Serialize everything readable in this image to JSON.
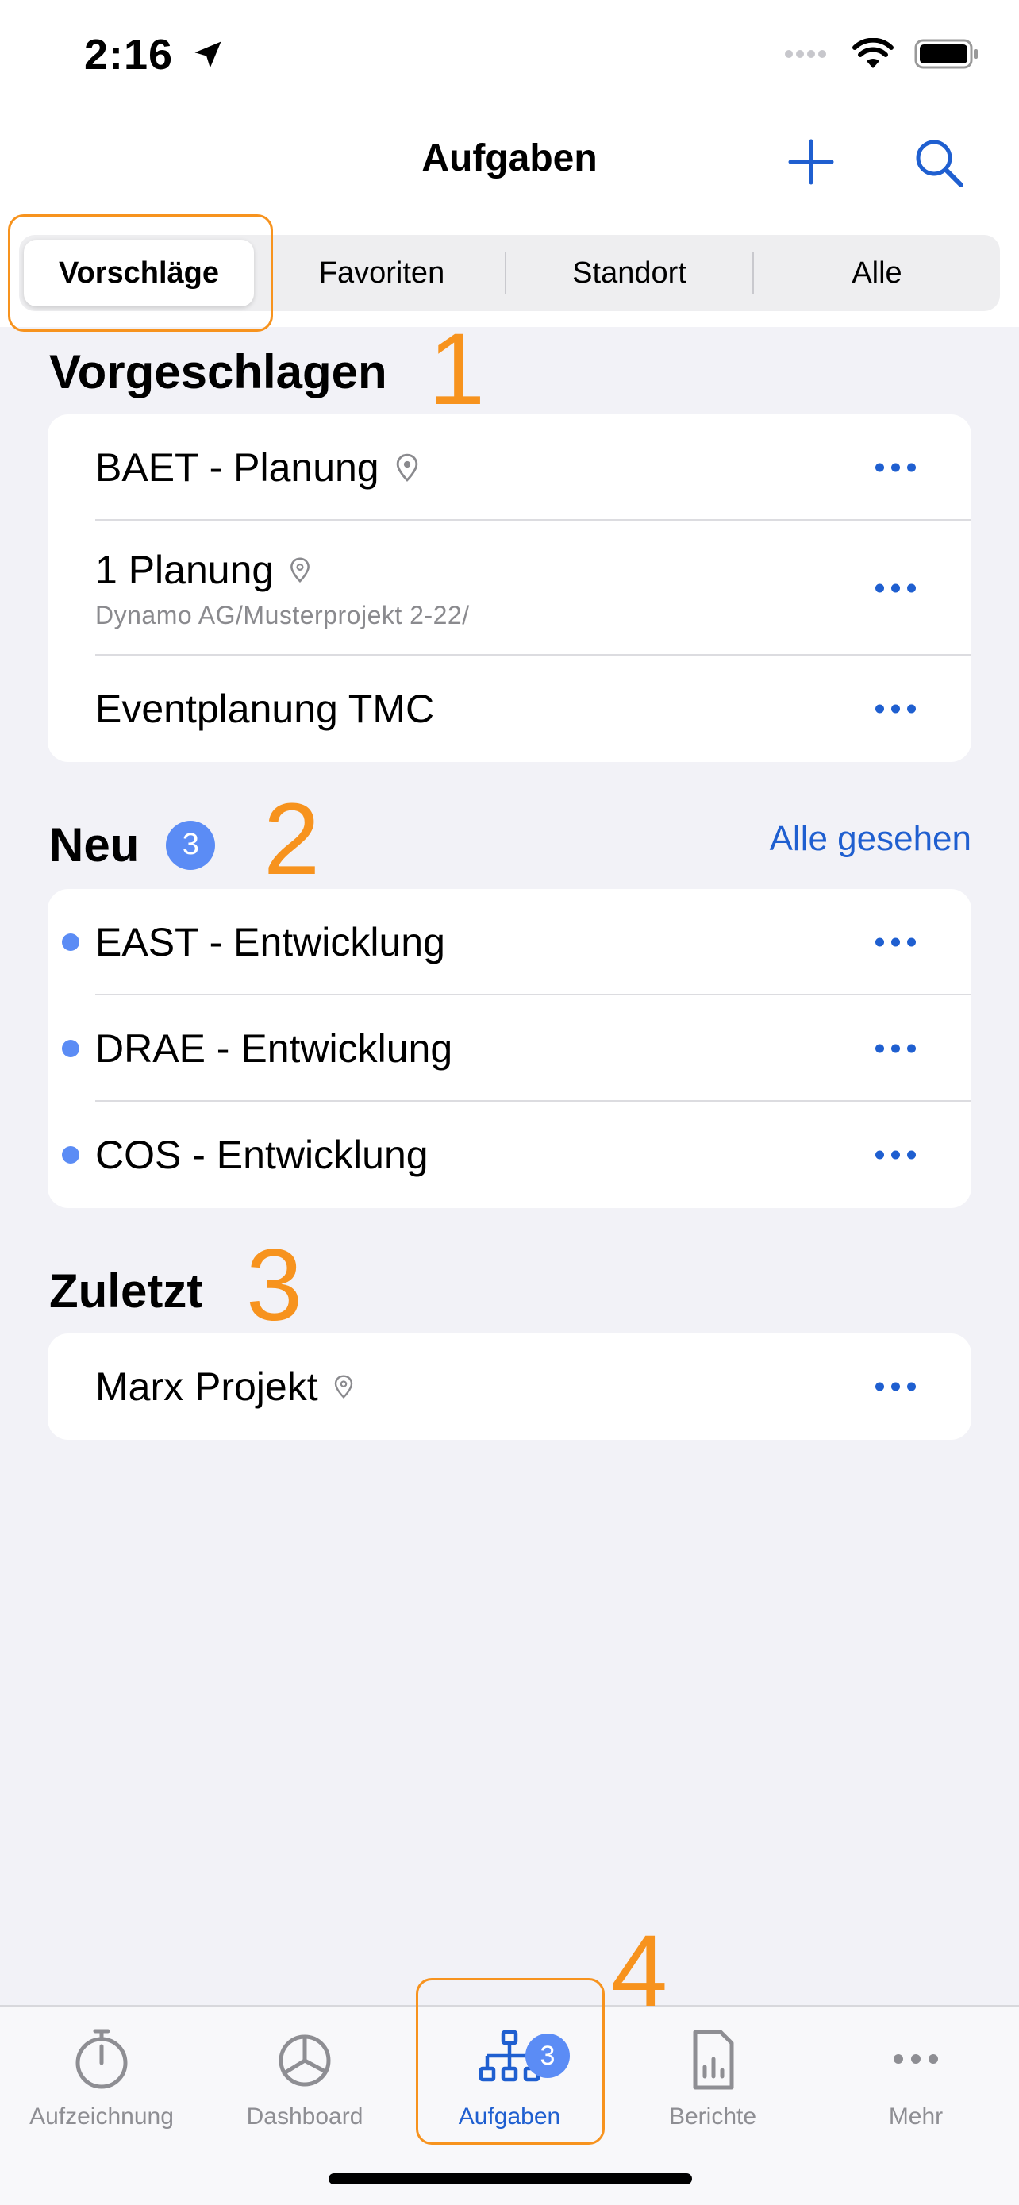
{
  "status_bar": {
    "time": "2:16"
  },
  "nav": {
    "title": "Aufgaben"
  },
  "segments": [
    {
      "label": "Vorschläge"
    },
    {
      "label": "Favoriten"
    },
    {
      "label": "Standort"
    },
    {
      "label": "Alle"
    }
  ],
  "annotations": [
    "1",
    "2",
    "3",
    "4"
  ],
  "suggested": {
    "title": "Vorgeschlagen",
    "items": [
      {
        "label": "BAET - Planung",
        "sub": ""
      },
      {
        "label": "1 Planung",
        "sub": "Dynamo AG/Musterprojekt 2-22/"
      },
      {
        "label": "Eventplanung TMC",
        "sub": ""
      }
    ]
  },
  "new": {
    "title": "Neu",
    "count": "3",
    "action": "Alle gesehen",
    "items": [
      {
        "label": "EAST - Entwicklung"
      },
      {
        "label": "DRAE - Entwicklung"
      },
      {
        "label": "COS - Entwicklung"
      }
    ]
  },
  "recent": {
    "title": "Zuletzt",
    "items": [
      {
        "label": "Marx Projekt"
      }
    ]
  },
  "tabbar": {
    "items": [
      {
        "label": "Aufzeichnung",
        "icon": "stopwatch-icon"
      },
      {
        "label": "Dashboard",
        "icon": "pie-chart-icon"
      },
      {
        "label": "Aufgaben",
        "icon": "hierarchy-icon",
        "badge": "3"
      },
      {
        "label": "Berichte",
        "icon": "report-icon"
      },
      {
        "label": "Mehr",
        "icon": "more-icon"
      }
    ]
  },
  "colors": {
    "accent": "#1f5fd0",
    "badge": "#5b8cf5",
    "annotation": "#f7931e"
  }
}
